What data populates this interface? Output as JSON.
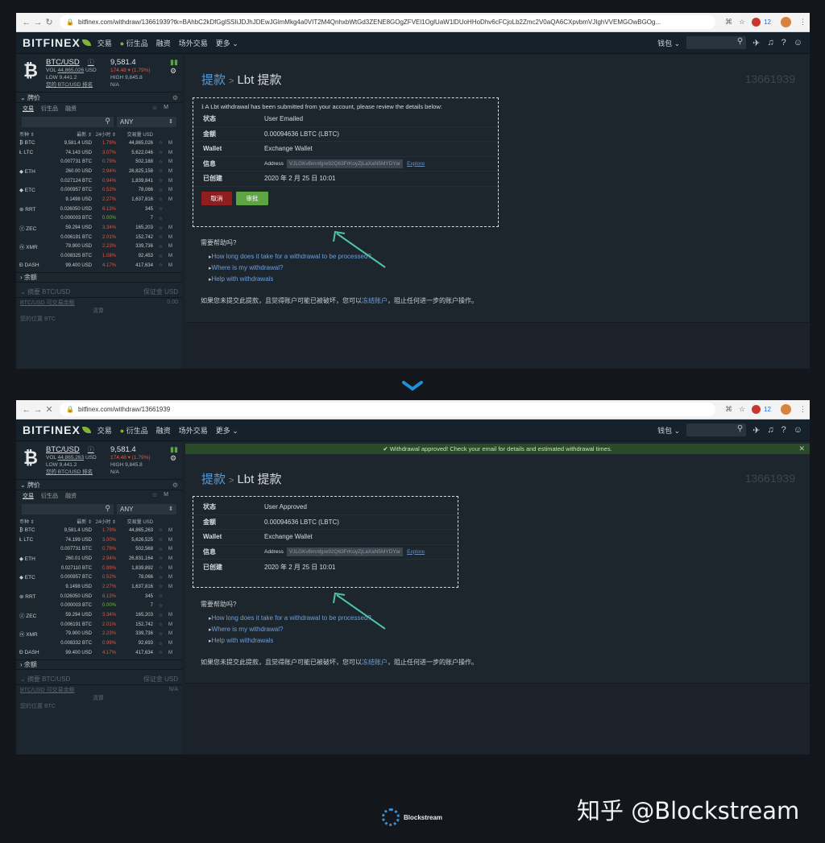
{
  "browser1": {
    "url": "bitfinex.com/withdraw/13661939?tk=BAhbC2kDfGglSSIiJDJhJDEwJGlmMkg4a0VIT2M4QnhxbWtGd3ZENE8GOgZFVEl1OglUaW1lDUoHHoDhv6cFCjoLb2Zmc2V0aQA6CXpvbmVJIghVVEMGOwBGOg...",
    "badge_count": "12"
  },
  "browser2": {
    "url": "bitfinex.com/withdraw/13661939",
    "badge_count": "12"
  },
  "nav": {
    "logo": "BITFINEX",
    "items": [
      "交易",
      "衍生品",
      "融资",
      "场外交易",
      "更多 ⌄"
    ],
    "wallet": "钱包 ⌄"
  },
  "ticker1": {
    "symbol": "BTC/USD",
    "price": "9,581.4",
    "vol_label": "VOL",
    "vol": "44,865,026",
    "vol_unit": "USD",
    "low_label": "LOW",
    "low": "9,441.2",
    "change": "174.48 ▾ (1.79%)",
    "high_label": "HIGH",
    "high": "9,845.8",
    "rank_label": "您的 BTC/USD 排名",
    "rank": "N/A"
  },
  "ticker2": {
    "symbol": "BTC/USD",
    "price": "9,581.4",
    "vol_label": "VOL",
    "vol": "44,865,263",
    "vol_unit": "USD",
    "low_label": "LOW",
    "low": "9,441.2",
    "change": "174.48 ▾ (1.79%)",
    "high_label": "HIGH",
    "high": "9,845.8",
    "rank_label": "您的 BTC/USD 排名",
    "rank": "N/A"
  },
  "sidebar": {
    "section_ticker": "牌价",
    "tabs": [
      "交易",
      "衍生品",
      "融资"
    ],
    "star": "☆",
    "m": "M",
    "filter_value": "ANY",
    "headers": {
      "coin": "币种 ⇕",
      "last": "最新 ⇕",
      "change": "24小时 ⇕",
      "volume": "交易量 USD"
    },
    "section_balance": "余额",
    "section_summary": "摘要 BTC/USD",
    "margin_label": "保证金",
    "margin_value": "USD",
    "tradable_label": "BTC/USD 可交易余额",
    "tradable_value": "0.00",
    "tradable_value2": "N/A",
    "small_label": "清算",
    "extra_label": "您的位置 BTC",
    "extra_label2": "BTC/USD",
    "extra_small": "BTCUSD"
  },
  "markets1": [
    {
      "sym": "BTC",
      "last": "9,581.4 USD",
      "chg": "1.79%",
      "dir": "red",
      "vol": "44,865,026"
    },
    {
      "sym": "LTC",
      "last": "74.143 USD",
      "chg": "3.07%",
      "dir": "red",
      "vol": "5,622,046"
    },
    {
      "sym": "",
      "last": "0.007731 BTC",
      "chg": "0.79%",
      "dir": "red",
      "vol": "502,188"
    },
    {
      "sym": "ETH",
      "last": "260.00 USD",
      "chg": "2.94%",
      "dir": "red",
      "vol": "26,825,158"
    },
    {
      "sym": "",
      "last": "0.027124 BTC",
      "chg": "0.94%",
      "dir": "red",
      "vol": "1,839,841"
    },
    {
      "sym": "ETC",
      "last": "0.000957 BTC",
      "chg": "0.52%",
      "dir": "red",
      "vol": "78,066"
    },
    {
      "sym": "",
      "last": "9.1498 USD",
      "chg": "2.27%",
      "dir": "red",
      "vol": "1,637,816"
    },
    {
      "sym": "RRT",
      "last": "0.026050 USD",
      "chg": "6.13%",
      "dir": "red",
      "vol": "345"
    },
    {
      "sym": "",
      "last": "0.000003 BTC",
      "chg": "0.00%",
      "dir": "green",
      "vol": "7"
    },
    {
      "sym": "ZEC",
      "last": "59.294 USD",
      "chg": "3.34%",
      "dir": "red",
      "vol": "165,203"
    },
    {
      "sym": "",
      "last": "0.006191 BTC",
      "chg": "2.01%",
      "dir": "red",
      "vol": "152,742"
    },
    {
      "sym": "XMR",
      "last": "79.900 USD",
      "chg": "2.23%",
      "dir": "red",
      "vol": "339,736"
    },
    {
      "sym": "",
      "last": "0.008325 BTC",
      "chg": "1.08%",
      "dir": "red",
      "vol": "92,453"
    },
    {
      "sym": "DASH",
      "last": "99.400 USD",
      "chg": "4.17%",
      "dir": "red",
      "vol": "417,634"
    }
  ],
  "markets2": [
    {
      "sym": "BTC",
      "last": "9,581.4 USD",
      "chg": "1.79%",
      "dir": "red",
      "vol": "44,865,263"
    },
    {
      "sym": "LTC",
      "last": "74.199 USD",
      "chg": "3.00%",
      "dir": "red",
      "vol": "5,626,525"
    },
    {
      "sym": "",
      "last": "0.007731 BTC",
      "chg": "0.79%",
      "dir": "red",
      "vol": "502,568"
    },
    {
      "sym": "ETH",
      "last": "260.01 USD",
      "chg": "2.94%",
      "dir": "red",
      "vol": "26,831,164"
    },
    {
      "sym": "",
      "last": "0.027110 BTC",
      "chg": "0.99%",
      "dir": "red",
      "vol": "1,839,892"
    },
    {
      "sym": "ETC",
      "last": "0.000957 BTC",
      "chg": "0.52%",
      "dir": "red",
      "vol": "78,066"
    },
    {
      "sym": "",
      "last": "9.1498 USD",
      "chg": "2.27%",
      "dir": "red",
      "vol": "1,637,816"
    },
    {
      "sym": "RRT",
      "last": "0.026050 USD",
      "chg": "6.13%",
      "dir": "red",
      "vol": "345"
    },
    {
      "sym": "",
      "last": "0.000003 BTC",
      "chg": "0.00%",
      "dir": "green",
      "vol": "7"
    },
    {
      "sym": "ZEC",
      "last": "59.294 USD",
      "chg": "3.34%",
      "dir": "red",
      "vol": "165,203"
    },
    {
      "sym": "",
      "last": "0.006191 BTC",
      "chg": "2.01%",
      "dir": "red",
      "vol": "152,742"
    },
    {
      "sym": "XMR",
      "last": "79.900 USD",
      "chg": "2.23%",
      "dir": "red",
      "vol": "339,736"
    },
    {
      "sym": "",
      "last": "0.008332 BTC",
      "chg": "0.99%",
      "dir": "red",
      "vol": "92,693"
    },
    {
      "sym": "DASH",
      "last": "99.400 USD",
      "chg": "4.17%",
      "dir": "red",
      "vol": "417,634"
    }
  ],
  "page": {
    "title_link": "提款",
    "title_sep": ">",
    "title": "Lbt 提款",
    "id": "13661939",
    "info": "A Lbt withdrawal has been submitted from your account, please review the details below:",
    "banner": "Withdrawal approved! Check your email for details and estimated withdrawal times.",
    "banner_close": "✕"
  },
  "details": {
    "status_label": "状态",
    "status1": "User Emailed",
    "status2": "User Approved",
    "amount_label": "金额",
    "amount": "0.00094636 LBTC (LBTC)",
    "wallet_label": "Wallet",
    "wallet": "Exchange Wallet",
    "info_label": "信息",
    "address_label": "Address",
    "address": "VJLGKvBmnfgre92Q63FrKoyZjLaXaN5MYDYar",
    "explore": "Explore",
    "created_label": "已创建",
    "created": "2020 年 2 月 25 日 10:01",
    "cancel": "取消",
    "approve": "审批"
  },
  "help": {
    "heading": "需要帮助吗?",
    "q1": "How long does it take for a withdrawal to be processed?",
    "q2": "Where is my withdrawal?",
    "q3": "Help with withdrawals"
  },
  "warning": {
    "before": "如果您未提交此提款，且觉得账户可能已被破坏，您可以",
    "link": "冻结账户",
    "after": "，阻止任何进一步的账户操作。"
  },
  "footer": {
    "watermark": "知乎 @Blockstream",
    "brand": "Blockstream"
  },
  "colors": {
    "accent": "#82b43c",
    "link": "#6e9fd8",
    "cancel": "#8f1f1f",
    "approve": "#5ca542",
    "arrow": "#4ec2a8"
  }
}
